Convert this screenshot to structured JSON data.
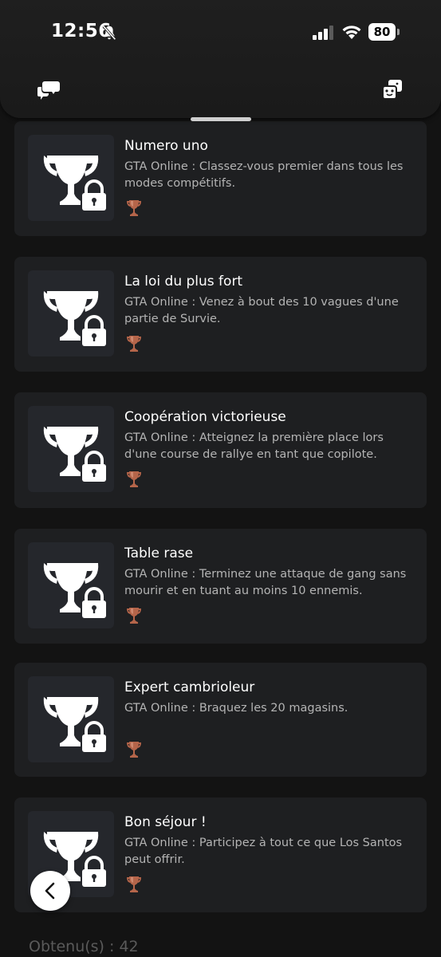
{
  "status_bar": {
    "time": "12:56",
    "battery": "80",
    "icons": [
      "bell-off-icon",
      "cellular-signal-icon",
      "wifi-icon",
      "battery-icon"
    ]
  },
  "header": {
    "left_icon": "chat-bubbles-icon",
    "right_icon": "game-dice-icon"
  },
  "trophies": [
    {
      "title": "Numero uno",
      "description": "GTA Online : Classez-vous premier dans tous les modes compétitifs.",
      "grade": "bronze"
    },
    {
      "title": "La loi du plus fort",
      "description": "GTA Online : Venez à bout des 10 vagues d'une partie de Survie.",
      "grade": "bronze"
    },
    {
      "title": "Coopération victorieuse",
      "description": "GTA Online : Atteignez la première place lors d'une course de rallye en tant que copilote.",
      "grade": "bronze"
    },
    {
      "title": "Table rase",
      "description": "GTA Online : Terminez une attaque de gang sans mourir et en tuant au moins 10 ennemis.",
      "grade": "bronze"
    },
    {
      "title": "Expert cambrioleur",
      "description": "GTA Online : Braquez les 20 magasins.",
      "grade": "bronze"
    },
    {
      "title": "Bon séjour !",
      "description": "GTA Online : Participez à tout ce que Los Santos peut offrir.",
      "grade": "bronze"
    }
  ],
  "footer": {
    "earned_label": "Obtenu(s) : 42"
  },
  "colors": {
    "background": "#131313",
    "card": "#1e1f21",
    "thumb": "#25272c",
    "bronze": "#b5654a",
    "text_secondary": "#b4b4b4"
  }
}
